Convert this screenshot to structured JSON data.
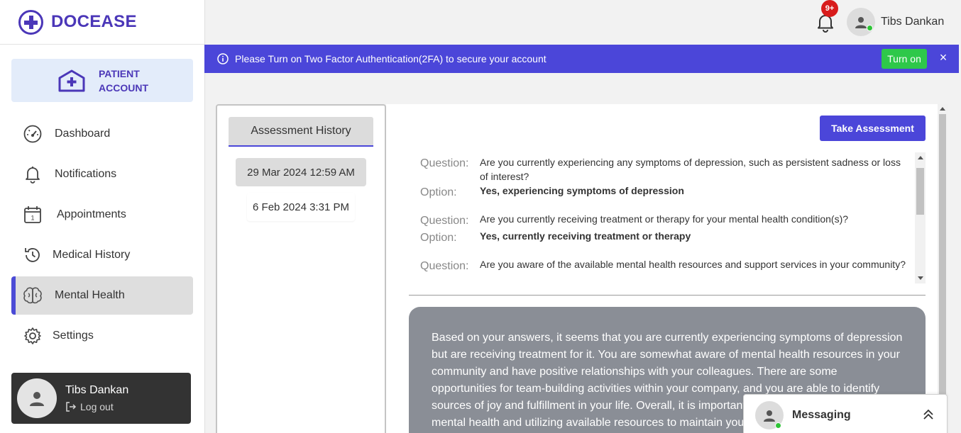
{
  "brand": {
    "name": "DOCEASE",
    "color": "#4b37b8"
  },
  "sidebar": {
    "account_label": "PATIENT ACCOUNT",
    "items": [
      {
        "label": "Dashboard",
        "icon": "dashboard-gauge-icon"
      },
      {
        "label": "Notifications",
        "icon": "bell-icon"
      },
      {
        "label": "Appointments",
        "icon": "calendar-icon"
      },
      {
        "label": "Medical History",
        "icon": "history-icon"
      },
      {
        "label": "Mental Health",
        "icon": "brain-icon",
        "active": true
      },
      {
        "label": "Settings",
        "icon": "gear-icon"
      }
    ],
    "user": {
      "name": "Tibs Dankan",
      "logout_label": "Log out"
    }
  },
  "header": {
    "notification_badge": "9+",
    "user_name": "Tibs Dankan"
  },
  "banner": {
    "message": "Please Turn on Two Factor Authentication(2FA) to secure your account",
    "action_label": "Turn on",
    "close_glyph": "×",
    "color": "#4b46d9"
  },
  "history": {
    "tab_label": "Assessment History",
    "items": [
      {
        "label": "29 Mar 2024 12:59 AM",
        "selected": true
      },
      {
        "label": "6 Feb 2024 3:31 PM",
        "selected": false
      }
    ]
  },
  "main": {
    "take_assessment_label": "Take Assessment",
    "question_label": "Question:",
    "option_label": "Option:",
    "qa": [
      {
        "question": "Are you currently experiencing any symptoms of depression, such as persistent sadness or loss of interest?",
        "option": "Yes, experiencing symptoms of depression"
      },
      {
        "question": "Are you currently receiving treatment or therapy for your mental health condition(s)?",
        "option": "Yes, currently receiving treatment or therapy"
      },
      {
        "question": "Are you aware of the available mental health resources and support services in your community?",
        "option": ""
      }
    ],
    "summary": "Based on your answers, it seems that you are currently experiencing symptoms of depression but are receiving treatment for it. You are somewhat aware of mental health resources in your community and have positive relationships with your colleagues. There are some opportunities for team-building activities within your company, and you are able to identify sources of joy and fulfillment in your life. Overall, it is important to continue prioritizing your mental health and utilizing available resources to maintain your mental well-being."
  },
  "messaging": {
    "label": "Messaging"
  }
}
